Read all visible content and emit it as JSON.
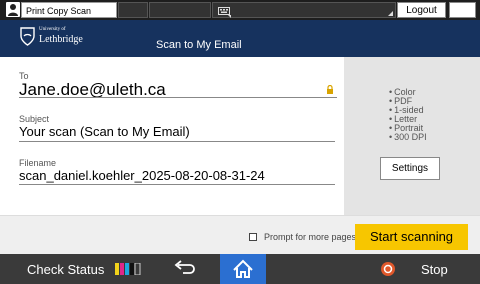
{
  "topbar": {
    "task_label": "Print Copy Scan",
    "logout_label": "Logout"
  },
  "header": {
    "uni_small": "University of",
    "uni_name": "Lethbridge",
    "title": "Scan to My Email"
  },
  "form": {
    "to": {
      "label": "To",
      "value": "Jane.doe@uleth.ca"
    },
    "subject": {
      "label": "Subject",
      "value": "Your scan (Scan to My Email)"
    },
    "filename": {
      "label": "Filename",
      "value": "scan_daniel.koehler_2025-08-20-08-31-24"
    }
  },
  "side": {
    "options": [
      "Color",
      "PDF",
      "1-sided",
      "Letter",
      "Portrait",
      "300 DPI"
    ],
    "settings_label": "Settings"
  },
  "actions": {
    "prompt_label": "Prompt for more pages",
    "prompt_checked": false,
    "start_label": "Start scanning"
  },
  "system": {
    "check_status_label": "Check Status",
    "stop_label": "Stop"
  },
  "colors": {
    "header_bg": "#16325e",
    "start_button": "#f7c600",
    "home_button": "#2b6fd1",
    "system_bar": "#3a3a3a",
    "stop_icon": "#e0582b"
  }
}
